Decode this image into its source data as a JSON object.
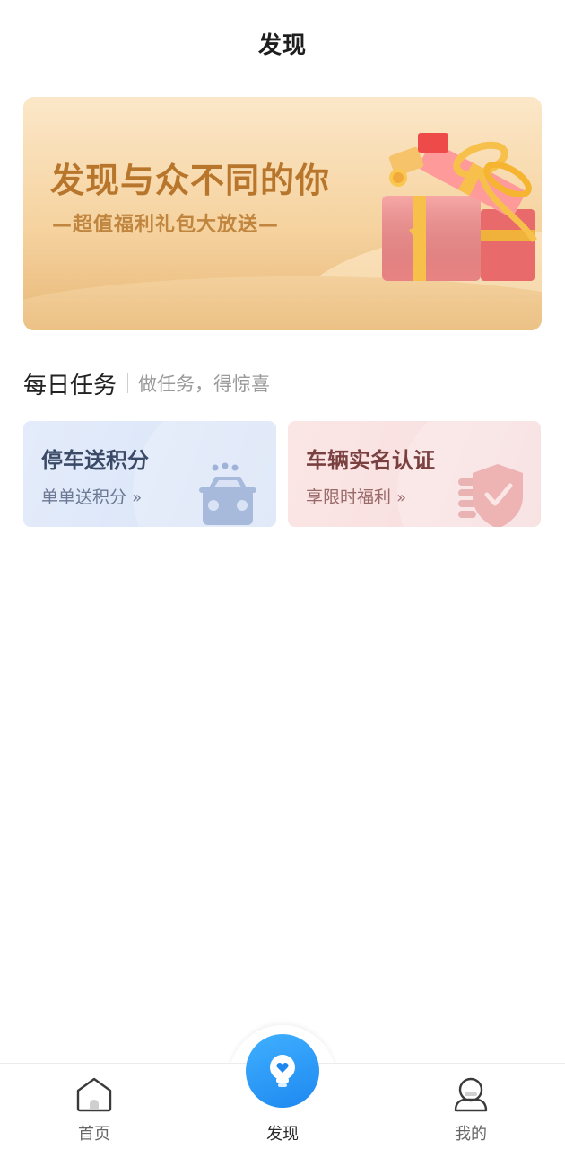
{
  "header": {
    "title": "发现"
  },
  "banner": {
    "title": "发现与众不同的你",
    "subtitle": "—超值福利礼包大放送—",
    "accent": "#b8762c"
  },
  "daily_tasks": {
    "title": "每日任务",
    "subtitle": "做任务，得惊喜",
    "cards": [
      {
        "title": "停车送积分",
        "subtitle": "单单送积分",
        "icon": "car-icon",
        "color": "#dfe8f9"
      },
      {
        "title": "车辆实名认证",
        "subtitle": "享限时福利",
        "icon": "shield-check-icon",
        "color": "#f9e1e1"
      }
    ]
  },
  "bottom_nav": {
    "items": [
      {
        "label": "首页",
        "icon": "home-icon"
      },
      {
        "label": "发现",
        "icon": "lightbulb-heart-icon",
        "active": true
      },
      {
        "label": "我的",
        "icon": "user-icon"
      }
    ],
    "active_color": "#1e88f0"
  }
}
